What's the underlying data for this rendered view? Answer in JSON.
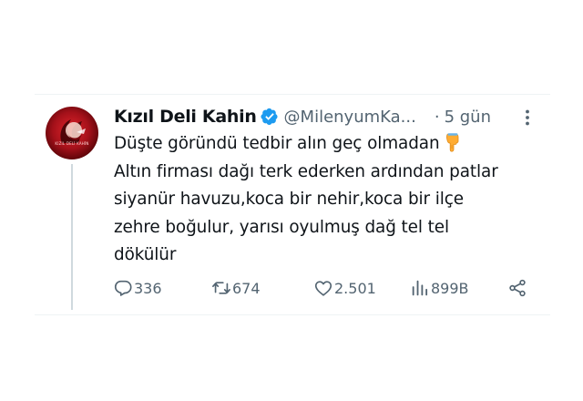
{
  "tweet": {
    "display_name": "Kızıl Deli Kahin",
    "handle": "@MilenyumKa...",
    "separator": "·",
    "time": "5 gün",
    "avatar_text": "KIZIL DELİ KAHİN",
    "lines": [
      "Düşte göründü tedbir alın geç olmadan",
      "Altın firması dağı terk ederken ardından patlar",
      "siyanür havuzu,koca bir nehir,koca bir ilçe",
      "zehre boğulur, yarısı oyulmuş dağ tel tel",
      "dökülür"
    ],
    "emoji": "backhand-index-pointing-down"
  },
  "actions": {
    "replies": "336",
    "retweets": "674",
    "likes": "2.501",
    "views": "899B"
  },
  "colors": {
    "text": "#0f1419",
    "muted": "#536471",
    "verified": "#1d9bf0",
    "divider": "#eff3f4",
    "thread_line": "#cfd9de",
    "avatar": "#c4141c"
  }
}
